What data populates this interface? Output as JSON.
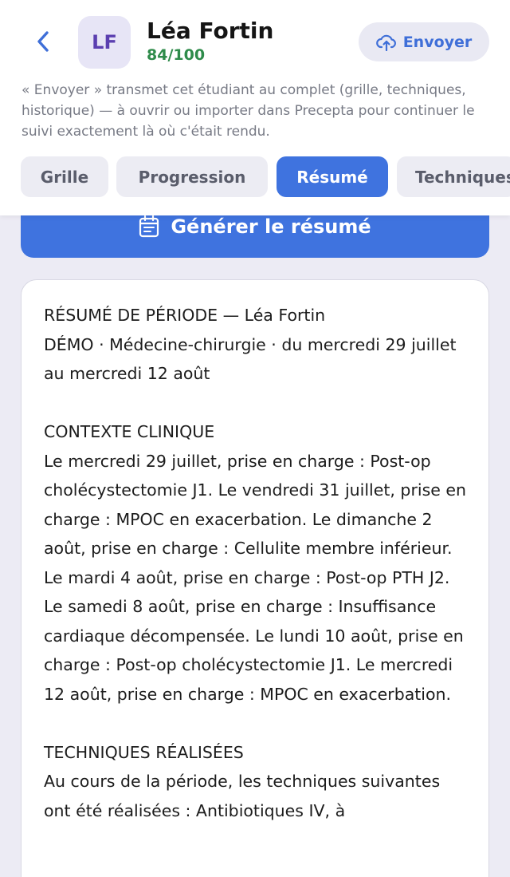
{
  "header": {
    "avatar_initials": "LF",
    "student_name": "Léa Fortin",
    "score": "84/100",
    "send_label": "Envoyer",
    "notice": "« Envoyer » transmet cet étudiant au complet (grille, techniques, historique) — à ouvrir ou importer dans Precepta pour continuer le suivi exactement là où c'était rendu."
  },
  "tabs": [
    {
      "label": "Grille"
    },
    {
      "label": "Progression"
    },
    {
      "label": "Résumé",
      "active": true
    },
    {
      "label": "Techniques"
    }
  ],
  "generate_label": "Générer le résumé",
  "summary": {
    "text": "RÉSUMÉ DE PÉRIODE — Léa Fortin\nDÉMO · Médecine-chirurgie · du mercredi 29 juillet au mercredi 12 août\n\nCONTEXTE CLINIQUE\nLe mercredi 29 juillet, prise en charge : Post-op cholécystectomie J1. Le vendredi 31 juillet, prise en charge : MPOC en exacerbation. Le dimanche 2 août, prise en charge : Cellulite membre inférieur. Le mardi 4 août, prise en charge : Post-op PTH J2. Le samedi 8 août, prise en charge : Insuffisance cardiaque décompensée. Le lundi 10 août, prise en charge : Post-op cholécystectomie J1. Le mercredi 12 août, prise en charge : MPOC en exacerbation.\n\nTECHNIQUES RÉALISÉES\nAu cours de la période, les techniques suivantes ont été réalisées : Antibiotiques IV, à"
  },
  "colors": {
    "accent": "#3f73df",
    "score_green": "#2e8b4a",
    "avatar_text": "#5b3fb0",
    "background": "#ecebf4"
  },
  "icons": {
    "back": "chevron-left-icon",
    "send": "cloud-upload-icon",
    "generate": "calendar-icon"
  }
}
